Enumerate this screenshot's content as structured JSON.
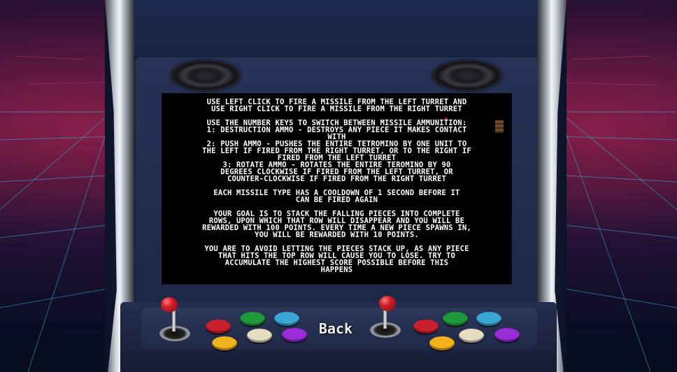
{
  "screen": {
    "instructions": [
      "Use left click to fire a missile from the left turret and\nuse right click to fire a missile from the right turret",
      "Use the number keys to switch between missile ammunition:\n1: Destruction ammo - destroys any piece it makes contact\nwith\n2: Push ammo - pushes the entire tetromino by one unit to\nthe left if fired from the right turret, or to the right if\nfired from the left turret\n3: Rotate ammo - rotates the entire teromino by 90\ndegrees clockwise if fired from the left turret, or\ncounter-clockwise if fired from the right turret",
      "Each missile type has a cooldown of 1 second before it\ncan be fired again",
      "Your goal is to stack the falling pieces into complete\nrows, upon which that row will disappear and you will be\nrewarded with 100 points. Every time a new piece spawns in,\nyou will be rewarded with 10 points.",
      "You are to avoid letting the pieces stack up, as any piece\nthat hits the top row will cause you to lose. Try to\naccumulate the highest score possible before this\nhappens"
    ]
  },
  "controls": {
    "back_label": "Back"
  },
  "colors": {
    "button_red": "#c8202c",
    "button_green": "#1f9a3a",
    "button_blue": "#3aa6d8",
    "button_yellow": "#f2b21a",
    "button_cream": "#e6dcc0",
    "button_purple": "#9a2cd8"
  }
}
